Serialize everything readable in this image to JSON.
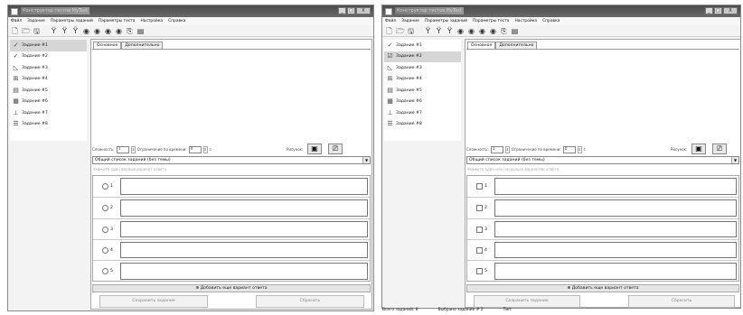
{
  "left": {
    "title": "Конструктор тестов MyTest",
    "menu": [
      "Файл",
      "Задание",
      "Параметры заданий",
      "Параметры теста",
      "Настройка",
      "Справка"
    ],
    "tasks": [
      "Задание #1",
      "Задание #2",
      "Задание #3",
      "Задание #4",
      "Задание #5",
      "Задание #6",
      "Задание #7",
      "Задание #8"
    ],
    "tabs": [
      "Основное",
      "Дополнительно"
    ],
    "difficulty_label": "Сложность:",
    "difficulty_value": "1",
    "time_limit_label": "Ограничение по времени:",
    "time_limit_value": "0",
    "time_unit": "с",
    "picture_label": "Рисунок:",
    "theme_combo": "Общий список заданий (без темы)",
    "hint": "Укажите один верный вариант ответа",
    "answer_numbers": [
      "1",
      "2",
      "3",
      "4",
      "5"
    ],
    "add_answer": "Добавить еще вариант ответа",
    "save_button": "Сохранить задание",
    "reset_button": "Сбросить"
  },
  "right": {
    "title": "Конструктор тестов MyTest",
    "menu": [
      "Файл",
      "Задание",
      "Параметры заданий",
      "Параметры теста",
      "Настройка",
      "Справка"
    ],
    "tasks": [
      "Задание #1",
      "Задание #2",
      "Задание #3",
      "Задание #4",
      "Задание #5",
      "Задание #6",
      "Задание #7",
      "Задание #8"
    ],
    "tabs": [
      "Основное",
      "Дополнительно"
    ],
    "difficulty_label": "Сложность:",
    "difficulty_value": "1",
    "time_limit_label": "Ограничение по времени:",
    "time_limit_value": "0",
    "time_unit": "с",
    "picture_label": "Рисунок:",
    "theme_combo": "Общий список заданий (без темы)",
    "hint": "Укажите один или несколько вариантов ответа",
    "answer_numbers": [
      "1",
      "2",
      "3",
      "4",
      "5"
    ],
    "add_answer": "Добавить еще вариант ответа",
    "save_button": "Сохранить задание",
    "reset_button": "Сбросить",
    "status": {
      "total": "Всего заданий: 8",
      "selected": "Выбрано задание # 2",
      "type": "Тип:"
    }
  },
  "window_controls": [
    "_",
    "□",
    "X"
  ],
  "toolbar_icons": [
    "new-file-icon",
    "open-folder-icon",
    "save-icon",
    "add-task-icon",
    "add-task-alt-icon",
    "delete-task-icon",
    "nav-first-icon",
    "nav-prev-icon",
    "nav-next-icon",
    "nav-last-icon",
    "copy-icon",
    "paste-icon"
  ],
  "colors": {
    "titlebar": "#5a5a5a",
    "selection": "#d6d6d6",
    "panel": "#f3f3f3"
  }
}
